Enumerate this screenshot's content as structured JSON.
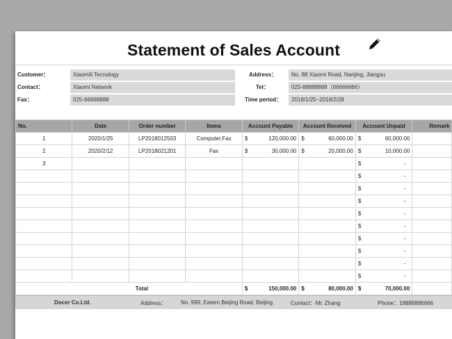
{
  "document": {
    "title": "Statement of Sales Account",
    "edit_icon": "pencil-icon"
  },
  "info": {
    "customer_label": "Customer：",
    "customer_value": "Xiaomili Tecnology",
    "contact_label": "Contact：",
    "contact_value": "Xiaomi Network",
    "fax_label": "Fax：",
    "fax_value": "025-66668888",
    "address_label": "Address：",
    "address_value": "No. 88 Xiaomi Road, Nanjing, Jiangsu",
    "tel_label": "Tel：",
    "tel_value": "025-88888888（66666666）",
    "period_label": "Time period：",
    "period_value": "2018/1/25~2018/2/28"
  },
  "table": {
    "headers": [
      "No.",
      "Date",
      "Order number",
      "Items",
      "Account Payable",
      "Account Received",
      "Account Unpaid",
      "Remark"
    ],
    "currency": "$",
    "dash": "-",
    "rows": [
      {
        "no": "1",
        "date": "2020/1/25",
        "order": "LP2018012503",
        "items": "Computer,Fax",
        "payable": "120,000.00",
        "received": "60,000.00",
        "unpaid": "60,000.00"
      },
      {
        "no": "2",
        "date": "2020/2/12",
        "order": "LP2018021201",
        "items": "Fax",
        "payable": "30,000.00",
        "received": "20,000.00",
        "unpaid": "10,000.00"
      },
      {
        "no": "3",
        "date": "",
        "order": "",
        "items": "",
        "payable": "",
        "received": "",
        "unpaid": "-"
      },
      {
        "no": "",
        "date": "",
        "order": "",
        "items": "",
        "payable": "",
        "received": "",
        "unpaid": "-"
      },
      {
        "no": "",
        "date": "",
        "order": "",
        "items": "",
        "payable": "",
        "received": "",
        "unpaid": "-"
      },
      {
        "no": "",
        "date": "",
        "order": "",
        "items": "",
        "payable": "",
        "received": "",
        "unpaid": "-"
      },
      {
        "no": "",
        "date": "",
        "order": "",
        "items": "",
        "payable": "",
        "received": "",
        "unpaid": "-"
      },
      {
        "no": "",
        "date": "",
        "order": "",
        "items": "",
        "payable": "",
        "received": "",
        "unpaid": "-"
      },
      {
        "no": "",
        "date": "",
        "order": "",
        "items": "",
        "payable": "",
        "received": "",
        "unpaid": "-"
      },
      {
        "no": "",
        "date": "",
        "order": "",
        "items": "",
        "payable": "",
        "received": "",
        "unpaid": "-"
      },
      {
        "no": "",
        "date": "",
        "order": "",
        "items": "",
        "payable": "",
        "received": "",
        "unpaid": "-"
      },
      {
        "no": "",
        "date": "",
        "order": "",
        "items": "",
        "payable": "",
        "received": "",
        "unpaid": "-"
      }
    ],
    "total": {
      "label": "Total",
      "payable": "150,000.00",
      "received": "80,000.00",
      "unpaid": "70,000.00"
    }
  },
  "footer": {
    "company": "Docer Co.Ltd.",
    "address_label": "Address：",
    "address_value": "No. 999, Eatern Beijing Road, Beijing",
    "contact": "Contact：Mr. Zhang",
    "phone": "Phone：18888886666"
  }
}
